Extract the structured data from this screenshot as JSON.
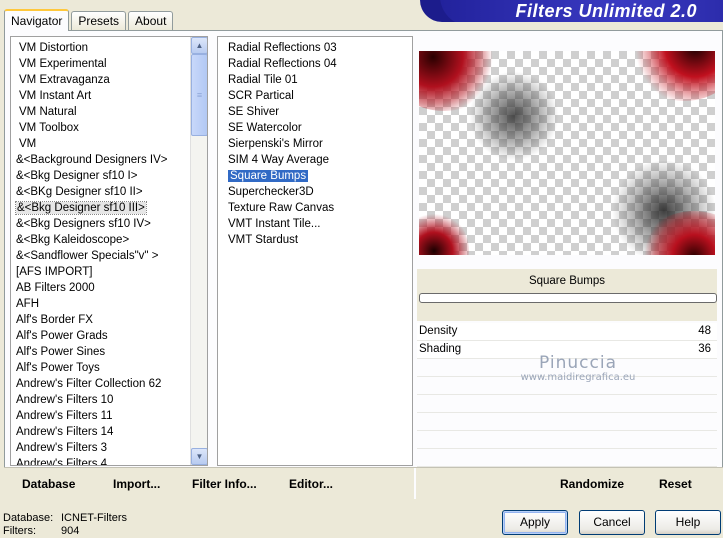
{
  "tabs": [
    {
      "label": "Navigator",
      "active": true
    },
    {
      "label": "Presets",
      "active": false
    },
    {
      "label": "About",
      "active": false
    }
  ],
  "banner": {
    "title": "Filters Unlimited 2.0"
  },
  "categories": [
    "VM Distortion",
    "VM Experimental",
    "VM Extravaganza",
    "VM Instant Art",
    "VM Natural",
    "VM Toolbox",
    "VM",
    "&<Background Designers IV>",
    "&<Bkg Designer sf10 I>",
    "&<BKg Designer sf10 II>",
    "&<Bkg Designer sf10 III>",
    "&<Bkg Designers sf10 IV>",
    "&<Bkg Kaleidoscope>",
    "&<Sandflower Specials\"v\" >",
    "[AFS IMPORT]",
    "AB Filters 2000",
    "AFH",
    "Alf's Border FX",
    "Alf's Power Grads",
    "Alf's Power Sines",
    "Alf's Power Toys",
    "Andrew's Filter Collection 62",
    "Andrew's Filters 10",
    "Andrew's Filters 11",
    "Andrew's Filters 14",
    "Andrew's Filters 3",
    "Andrew's Filters 4"
  ],
  "selected_category_index": 10,
  "filters": [
    "Radial Reflections 03",
    "Radial Reflections 04",
    "Radial Tile 01",
    "SCR  Partical",
    "SE Shiver",
    "SE Watercolor",
    "Sierpenski's Mirror",
    "SIM 4 Way Average",
    "Square Bumps",
    "Superchecker3D",
    "Texture Raw Canvas",
    "VMT Instant Tile...",
    "VMT Stardust"
  ],
  "selected_filter_index": 8,
  "current_filter": {
    "name": "Square Bumps",
    "progress": 0
  },
  "params": [
    {
      "label": "Density",
      "value": "48"
    },
    {
      "label": "Shading",
      "value": "36"
    }
  ],
  "watermark": {
    "name": "Pinuccia",
    "url": "www.maidiregrafica.eu"
  },
  "toolbar": {
    "database": "Database",
    "import": "Import...",
    "filter_info": "Filter Info...",
    "editor": "Editor...",
    "randomize": "Randomize",
    "reset": "Reset"
  },
  "status": {
    "database_label": "Database:",
    "database_value": "ICNET-Filters",
    "filters_label": "Filters:",
    "filters_value": "904"
  },
  "buttons": {
    "apply": "Apply",
    "cancel": "Cancel",
    "help": "Help"
  },
  "icons": {
    "scroll_up": "chevron-up-icon",
    "scroll_down": "chevron-down-icon"
  }
}
